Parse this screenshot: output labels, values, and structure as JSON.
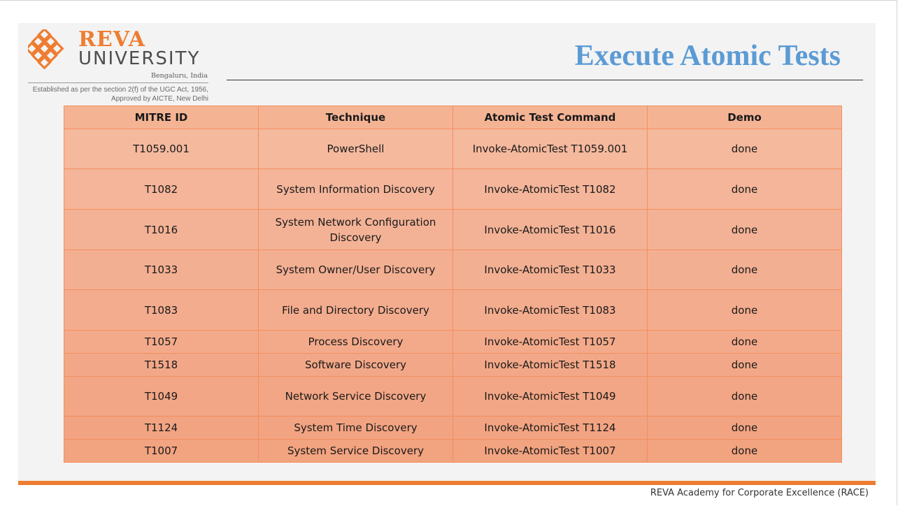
{
  "logo": {
    "name": "REVA",
    "subtitle": "UNIVERSITY",
    "city": "Bengaluru, India",
    "established_line1": "Established as per the section 2(f) of the UGC Act, 1956,",
    "established_line2": "Approved by AICTE, New Delhi",
    "icon": "reva-knot-logo-icon"
  },
  "slide": {
    "title": "Execute Atomic Tests"
  },
  "table": {
    "headers": [
      "MITRE ID",
      "Technique",
      "Atomic Test Command",
      "Demo"
    ],
    "rows": [
      {
        "id": "T1059.001",
        "technique": "PowerShell",
        "command": "Invoke-AtomicTest T1059.001",
        "demo": "done"
      },
      {
        "id": "T1082",
        "technique": "System Information Discovery",
        "command": "Invoke-AtomicTest T1082",
        "demo": "done"
      },
      {
        "id": "T1016",
        "technique": "System Network Configuration Discovery",
        "command": "Invoke-AtomicTest T1016",
        "demo": "done"
      },
      {
        "id": "T1033",
        "technique": "System Owner/User Discovery",
        "command": "Invoke-AtomicTest T1033",
        "demo": "done"
      },
      {
        "id": "T1083",
        "technique": "File and Directory Discovery",
        "command": "Invoke-AtomicTest T1083",
        "demo": "done"
      },
      {
        "id": "T1057",
        "technique": "Process Discovery",
        "command": "Invoke-AtomicTest T1057",
        "demo": "done"
      },
      {
        "id": "T1518",
        "technique": "Software Discovery",
        "command": "Invoke-AtomicTest T1518",
        "demo": "done"
      },
      {
        "id": "T1049",
        "technique": "Network Service Discovery",
        "command": "Invoke-AtomicTest T1049",
        "demo": "done"
      },
      {
        "id": "T1124",
        "technique": "System Time Discovery",
        "command": "Invoke-AtomicTest T1124",
        "demo": "done"
      },
      {
        "id": "T1007",
        "technique": "System Service Discovery",
        "command": "Invoke-AtomicTest T1007",
        "demo": "done"
      }
    ]
  },
  "footer": {
    "text": "REVA Academy for Corporate Excellence (RACE)"
  },
  "colors": {
    "accent_orange": "#ee7d31",
    "title_blue": "#5b9bd5",
    "table_header": "#f4b494",
    "table_border": "#f48e5d"
  }
}
